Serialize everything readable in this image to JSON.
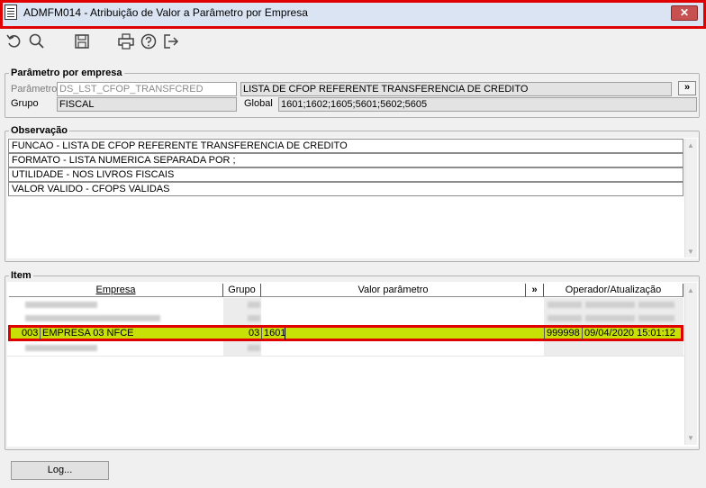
{
  "window": {
    "title": "ADMFM014 - Atribuição de Valor a Parâmetro por Empresa",
    "close_label": "✕"
  },
  "toolbar": {
    "icons": [
      "undo-icon",
      "search-icon",
      "save-icon",
      "print-icon",
      "help-icon",
      "exit-icon"
    ]
  },
  "param_group": {
    "title": "Parâmetro por empresa",
    "parametro_label": "Parâmetro",
    "parametro_value": "DS_LST_CFOP_TRANSFCRED",
    "descricao_value": "LISTA DE CFOP REFERENTE TRANSFERENCIA DE CREDITO",
    "expand_label": "»",
    "grupo_label": "Grupo",
    "grupo_value": "FISCAL",
    "global_label": "Global",
    "global_value": "1601;1602;1605;5601;5602;5605"
  },
  "observacao": {
    "title": "Observação",
    "lines": [
      "FUNCAO - LISTA DE CFOP REFERENTE TRANSFERENCIA DE CREDITO",
      "FORMATO - LISTA NUMERICA SEPARADA POR ;",
      "UTILIDADE - NOS LIVROS FISCAIS",
      "VALOR VALIDO - CFOPS VALIDAS"
    ]
  },
  "item": {
    "title": "Item",
    "headers": {
      "empresa": "Empresa",
      "grupo": "Grupo",
      "valor": "Valor parâmetro",
      "expand": "»",
      "operador": "Operador/Atualização"
    },
    "selected_row": {
      "empresa_code": "003",
      "empresa_name": "EMPRESA 03 NFCE",
      "grupo": "03",
      "valor": "1601",
      "operador": "999998",
      "atualizacao": "09/04/2020 15:01:12"
    }
  },
  "log_button": "Log...",
  "colors": {
    "highlight_row": "#c7e006",
    "annotation_border": "#e00000"
  }
}
